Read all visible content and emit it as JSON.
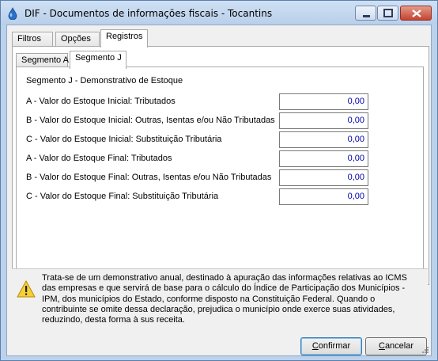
{
  "window": {
    "title": "DIF - Documentos de informações fiscais - Tocantins"
  },
  "outer_tabs": [
    {
      "label": "Filtros"
    },
    {
      "label": "Opções"
    },
    {
      "label": "Registros"
    }
  ],
  "inner_tabs": [
    {
      "label": "Segmento A"
    },
    {
      "label": "Segmento J"
    }
  ],
  "section": {
    "title": "Segmento J - Demonstrativo de Estoque",
    "rows": [
      {
        "label": "A - Valor do Estoque Inicial: Tributados",
        "value": "0,00"
      },
      {
        "label": "B - Valor do Estoque Inicial: Outras, Isentas e/ou Não Tributadas",
        "value": "0,00"
      },
      {
        "label": "C - Valor do Estoque Inicial: Substituição  Tributária",
        "value": "0,00"
      },
      {
        "label": "A - Valor do Estoque Final: Tributados",
        "value": "0,00"
      },
      {
        "label": "B - Valor do Estoque Final: Outras, Isentas e/ou Não Tributadas",
        "value": "0,00"
      },
      {
        "label": "C - Valor do Estoque Final: Substituição  Tributária",
        "value": "0,00"
      }
    ]
  },
  "info": {
    "icon": "warning-icon",
    "text": "Trata-se de um demonstrativo anual, destinado à apuração das informações relativas ao ICMS das empresas e que servirá de base para o cálculo do Índice de Participação dos Municípios - IPM, dos municípios do Estado, conforme disposto na Constituição Federal. Quando o contribuinte se omite dessa declaração, prejudica o município onde exerce suas atividades, reduzindo,  desta forma à sus receita."
  },
  "buttons": {
    "confirm_first": "C",
    "confirm_rest": "onfirmar",
    "cancel_first": "C",
    "cancel_rest": "ancelar"
  },
  "colors": {
    "frame": "#bcd1ea",
    "value_text": "#0000aa",
    "close_button": "#c5432f"
  }
}
